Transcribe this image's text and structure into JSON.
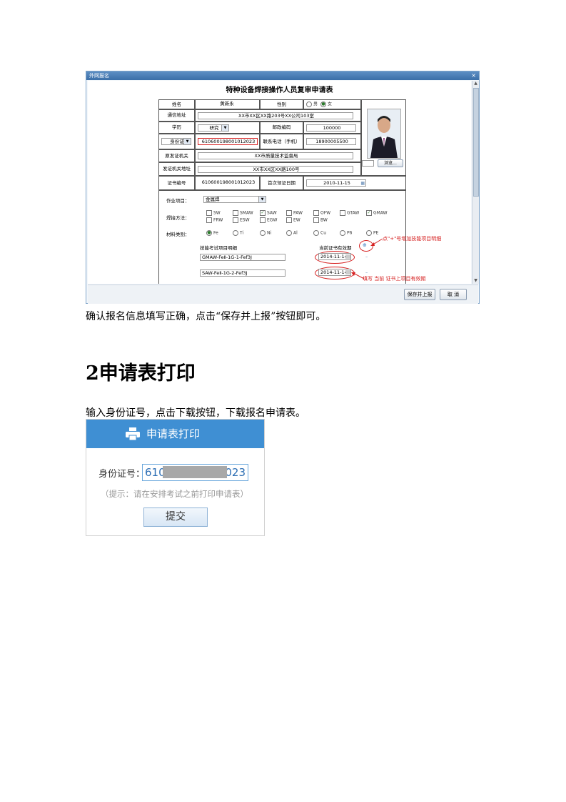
{
  "dialog": {
    "title": "外网报名",
    "close": "×",
    "form_title": "特种设备焊接操作人员复审申请表",
    "fields": {
      "name_label": "姓名",
      "name_value": "黄新永",
      "gender_label": "性别",
      "gender_male": "男",
      "gender_female": "女",
      "address_label": "通信地址",
      "address_value": "XX市XX区XX路203号XX公司103室",
      "edu_label": "学历",
      "edu_value": "研究",
      "postcode_label": "邮政编码",
      "postcode_value": "100000",
      "idtype_value": "身份证",
      "id_value": "610600198001012023",
      "phone_label": "联系电话（手机）",
      "phone_value": "18900005500",
      "orig_authority_label": "原发证机关",
      "orig_authority_value": "XX市质量技术监督局",
      "authority_addr_label": "发证机关地址",
      "authority_addr_value": "XX市XX区XX路100号",
      "cert_no_label": "证书编号",
      "cert_no_value": "610600198001012023",
      "first_date_label": "首次领证日期",
      "first_date_value": "2010-11-15",
      "browse": "浏览...",
      "work_item_label": "作业项目：",
      "work_item_value": "金属焊",
      "method_label": "焊接方法：",
      "methods_row1": [
        "SW",
        "SMAW",
        "SAW",
        "PAW",
        "OFW",
        "GTAW",
        "GMAW"
      ],
      "methods_row2": [
        "FRW",
        "ESW",
        "EGW",
        "EW",
        "BW"
      ],
      "material_label": "材料类别：",
      "materials": [
        "Fe",
        "Ti",
        "Ni",
        "Al",
        "Cu",
        "P6",
        "PE"
      ],
      "detail_label": "技能考试项目明细",
      "validity_label": "当前证书有效期",
      "item1": "GMAW-FeⅡ-1G-1-Fef3J",
      "item1_date": "2014-11-14",
      "item2": "SAW-FeⅡ-1G-2-Fef3J",
      "item2_date": "2014-11-14",
      "minus1": "–",
      "minus2": "–"
    },
    "annotation1": "点\"+\"号增加技能项目明细",
    "annotation2": "填写 当前 证书上项目有效期",
    "save_button": "保存并上报",
    "cancel_button": "取 消"
  },
  "para1": "确认报名信息填写正确，点击“保存并上报”按钮即可。",
  "heading": "2申请表打印",
  "para2": "输入身份证号，点击下载按钮，下载报名申请表。",
  "print_panel": {
    "title": "申请表打印",
    "id_label": "身份证号：",
    "id_prefix": "610",
    "id_suffix": "023",
    "hint": "（提示：请在安排考试之前打印申请表）",
    "submit": "提交"
  },
  "colors": {
    "panel_header": "#3f8fd3",
    "annotation": "#d62020",
    "dialog_header": "#3b6fa8"
  }
}
